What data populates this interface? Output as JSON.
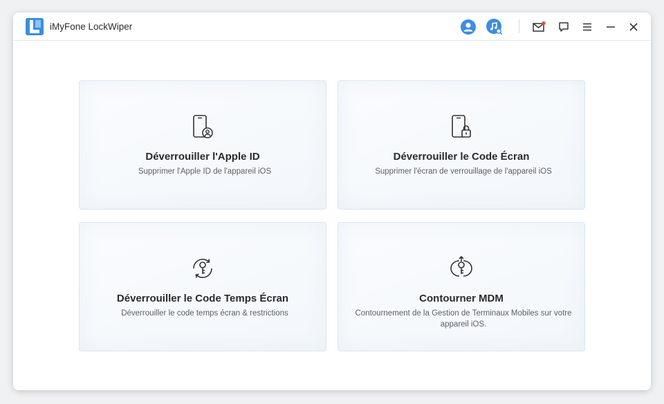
{
  "app": {
    "title": "iMyFone LockWiper"
  },
  "titlebar": {
    "icons": [
      "user-account-icon",
      "music-search-icon",
      "mail-notification-icon",
      "feedback-icon",
      "menu-icon",
      "minimize-icon",
      "close-icon"
    ]
  },
  "colors": {
    "accent": "#3b8ee0",
    "notification_dot": "#e84a3c",
    "text": "#2b2b2b",
    "subtext": "#5c6068"
  },
  "cards": [
    {
      "title": "Déverrouiller l'Apple ID",
      "desc": "Supprimer l'Apple ID de l'appareil iOS",
      "icon": "phone-user-icon"
    },
    {
      "title": "Déverrouiller le Code Écran",
      "desc": "Supprimer l'écran de verrouillage de l'appareil iOS",
      "icon": "phone-lock-icon"
    },
    {
      "title": "Déverrouiller le Code Temps Écran",
      "desc": "Déverrouiller le code temps écran & restrictions",
      "icon": "key-refresh-icon"
    },
    {
      "title": "Contourner MDM",
      "desc": "Contournement de la Gestion de Terminaux Mobiles sur votre appareil iOS.",
      "icon": "key-bypass-icon"
    }
  ]
}
